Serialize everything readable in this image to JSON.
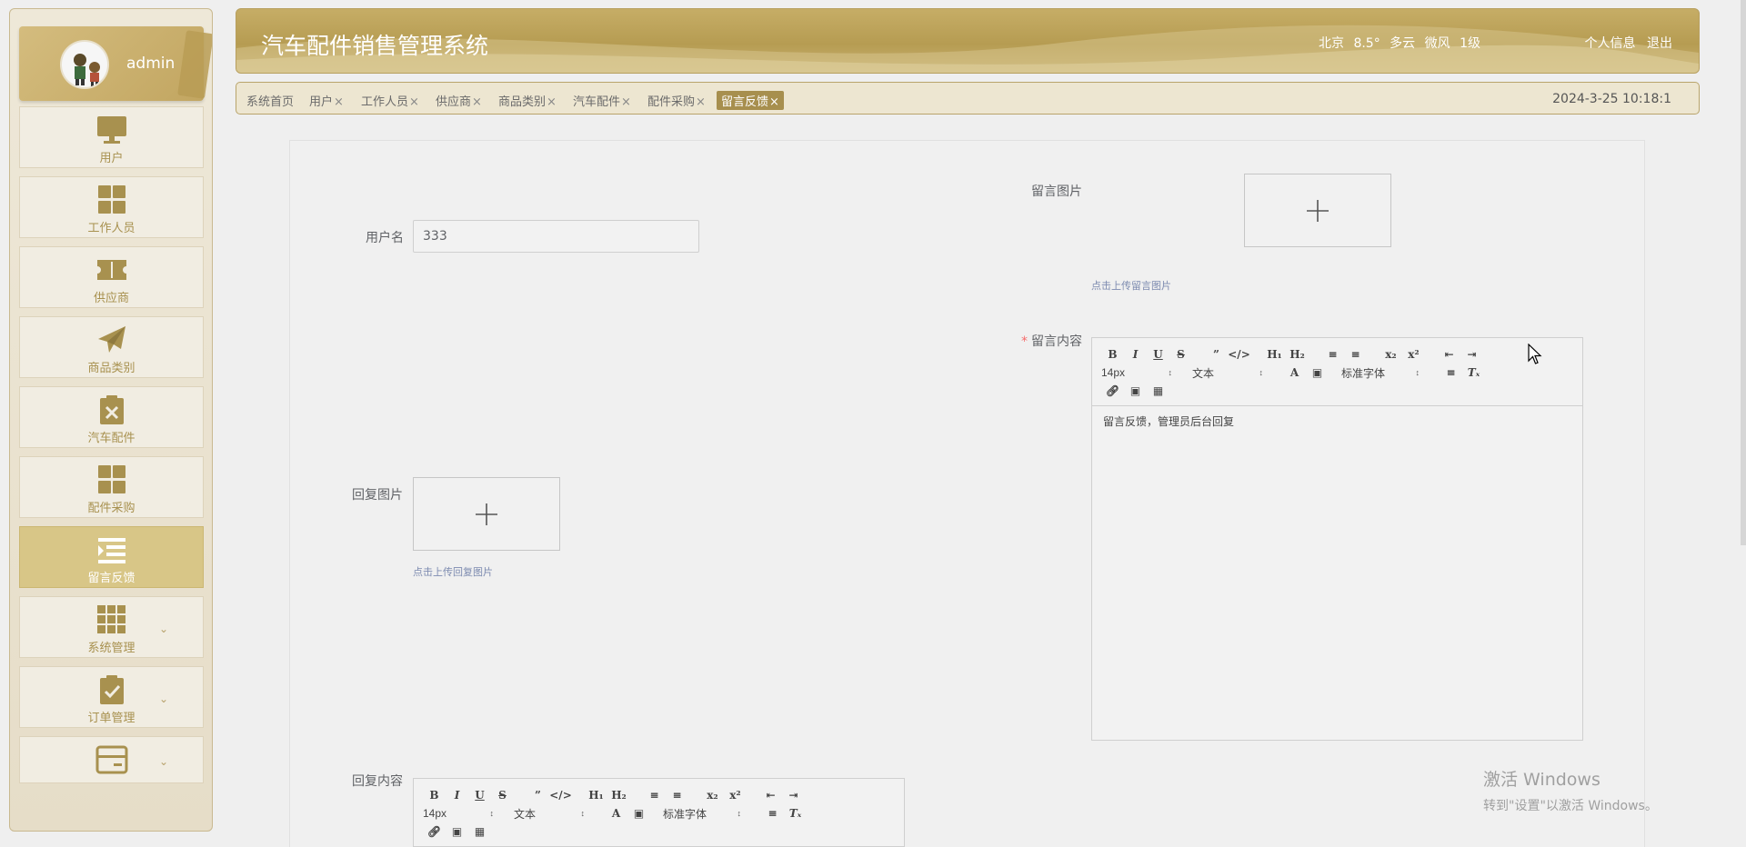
{
  "app": {
    "title": "汽车配件销售管理系统"
  },
  "user": {
    "name": "admin"
  },
  "header": {
    "weather": {
      "city": "北京",
      "temp": "8.5°",
      "condition": "多云",
      "wind": "微风",
      "level": "1级"
    },
    "links": {
      "profile": "个人信息",
      "logout": "退出"
    }
  },
  "sidebar": {
    "items": [
      {
        "label": "用户",
        "icon": "monitor-icon"
      },
      {
        "label": "工作人员",
        "icon": "grid-icon"
      },
      {
        "label": "供应商",
        "icon": "ticket-icon"
      },
      {
        "label": "商品类别",
        "icon": "paper-plane-icon"
      },
      {
        "label": "汽车配件",
        "icon": "clipboard-x-icon"
      },
      {
        "label": "配件采购",
        "icon": "grid-icon"
      },
      {
        "label": "留言反馈",
        "icon": "list-indent-icon",
        "active": true
      },
      {
        "label": "系统管理",
        "icon": "apps-icon"
      },
      {
        "label": "订单管理",
        "icon": "clipboard-check-icon"
      },
      {
        "label": "",
        "icon": "card-icon"
      }
    ]
  },
  "tabs": [
    {
      "label": "系统首页",
      "closable": false
    },
    {
      "label": "用户",
      "closable": true
    },
    {
      "label": "工作人员",
      "closable": true
    },
    {
      "label": "供应商",
      "closable": true
    },
    {
      "label": "商品类别",
      "closable": true
    },
    {
      "label": "汽车配件",
      "closable": true
    },
    {
      "label": "配件采购",
      "closable": true
    },
    {
      "label": "留言反馈",
      "closable": true,
      "active": true
    }
  ],
  "tab_close_symbol": "×",
  "datetime": "2024-3-25 10:18:1",
  "form": {
    "username_label": "用户名",
    "username_value": "333",
    "message_image_label": "留言图片",
    "message_image_hint": "点击上传留言图片",
    "message_content_required": "*",
    "message_content_label": "留言内容",
    "message_content_value": "留言反馈，管理员后台回复",
    "reply_image_label": "回复图片",
    "reply_image_hint": "点击上传回复图片",
    "reply_content_label": "回复内容"
  },
  "editor_toolbar": {
    "size": "14px",
    "header": "文本",
    "font": "标准字体"
  },
  "watermark": {
    "line1": "激活 Windows",
    "line2": "转到\"设置\"以激活 Windows。"
  },
  "colors": {
    "accent": "#b69c52",
    "active_menu": "#d8c687",
    "active_tab": "#a78f4e",
    "required": "#f56c6c"
  }
}
